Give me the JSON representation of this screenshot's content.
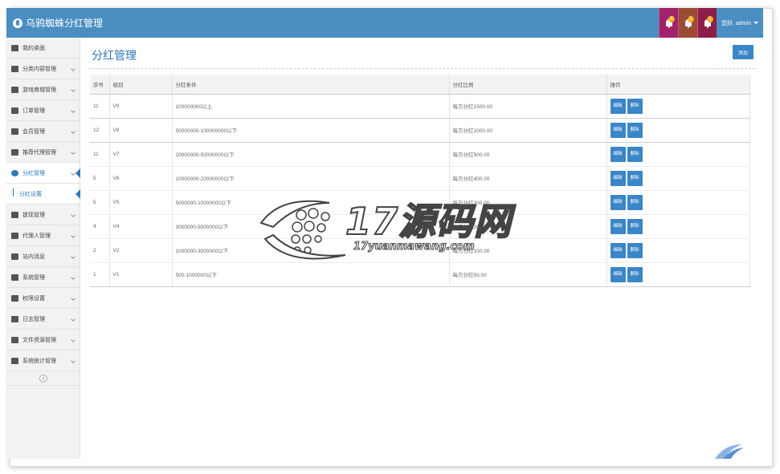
{
  "app": {
    "title": "乌鸦蜘蛛分红管理",
    "user_label": "您好, admin",
    "notifications": [
      {
        "icon": "bell-icon",
        "count": "8"
      },
      {
        "icon": "bell-icon",
        "count": "1"
      },
      {
        "icon": "bell-icon",
        "count": "1"
      }
    ]
  },
  "sidebar": {
    "items": [
      {
        "label": "我的桌面",
        "icon": "home-icon",
        "has_chevron": false
      },
      {
        "label": "分类内容管理",
        "icon": "list-icon",
        "has_chevron": true
      },
      {
        "label": "游戏商城管理",
        "icon": "gamepad-icon",
        "has_chevron": true
      },
      {
        "label": "订单管理",
        "icon": "yen-icon",
        "has_chevron": true
      },
      {
        "label": "会员管理",
        "icon": "user-icon",
        "has_chevron": true
      },
      {
        "label": "推荐代理管理",
        "icon": "table-icon",
        "has_chevron": true
      },
      {
        "label": "分红管理",
        "icon": "globe-icon",
        "has_chevron": true,
        "active": true
      }
    ],
    "sub_item": "分红设置",
    "items_after": [
      {
        "label": "提现管理",
        "icon": "clock-icon"
      },
      {
        "label": "代理人管理",
        "icon": "sitemap-icon"
      },
      {
        "label": "站内消息",
        "icon": "envelope-icon"
      },
      {
        "label": "系统管理",
        "icon": "monitor-icon"
      },
      {
        "label": "权限设置",
        "icon": "settings-icon"
      },
      {
        "label": "日志管理",
        "icon": "camera-icon"
      },
      {
        "label": "文件资源管理",
        "icon": "file-icon"
      },
      {
        "label": "系统统计管理",
        "icon": "group-icon"
      }
    ]
  },
  "main": {
    "title": "分红管理",
    "add_label": "添加",
    "columns": [
      "序号",
      "级别",
      "分红条件",
      "分红比例",
      "操作"
    ],
    "rows": [
      {
        "id": "11",
        "level": "V9",
        "condition": "100000000以上",
        "ratio": "每万分红1500.00"
      },
      {
        "id": "12",
        "level": "V8",
        "condition": "50000000-100000000以下",
        "ratio": "每万分红1000.00"
      },
      {
        "id": "11",
        "level": "V7",
        "condition": "20000000-50000000以下",
        "ratio": "每万分红500.00"
      },
      {
        "id": "5",
        "level": "V6",
        "condition": "10000000-20000000以下",
        "ratio": "每万分红400.00"
      },
      {
        "id": "5",
        "level": "V5",
        "condition": "5000000-10000000以下",
        "ratio": "每万分红300.00"
      },
      {
        "id": "4",
        "level": "V4",
        "condition": "3000000-5000000以下",
        "ratio": "每万分红200.00"
      },
      {
        "id": "2",
        "level": "V2",
        "condition": "1000000-3000000以下",
        "ratio": "每万分红100.00"
      },
      {
        "id": "1",
        "level": "V1",
        "condition": "500-1000000以下",
        "ratio": "每万分红50.00"
      }
    ],
    "edit_label": "编辑",
    "delete_label": "删除"
  },
  "watermark": {
    "text": "17源码网",
    "sub": "17yuanmawang.com"
  }
}
